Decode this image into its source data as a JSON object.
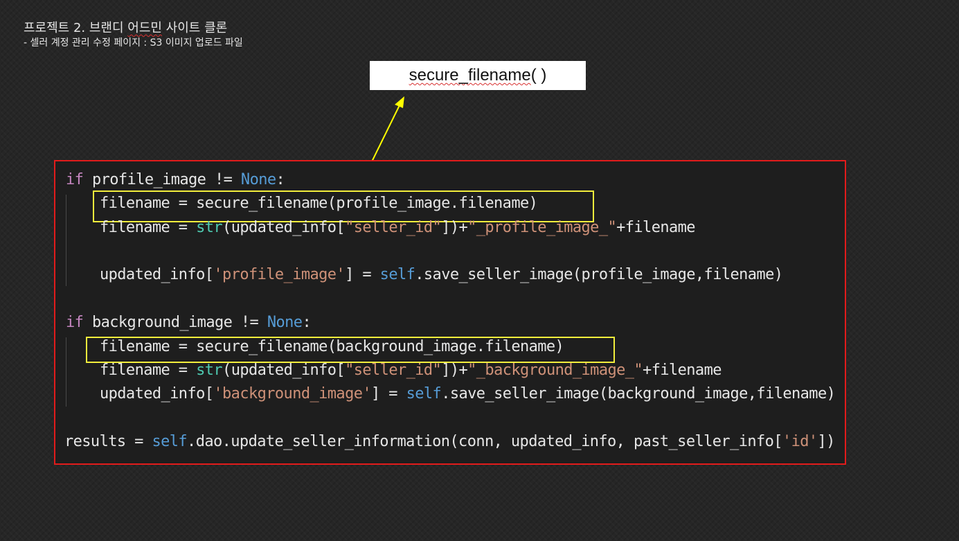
{
  "slide": {
    "title_prefix": "프로젝트 2. 브랜디 ",
    "title_word": "어드민",
    "title_suffix": " 사이트 클론",
    "subtitle": "- 셀러 계정 관리 수정 페이지 : S3 이미지 업로드 파일"
  },
  "callout": {
    "label_main": "secure_filename",
    "label_tail": "( )"
  },
  "code": {
    "line1": {
      "kw": "if",
      "a": " profile_image != ",
      "const": "None",
      "b": ":"
    },
    "line2": {
      "text": "filename = secure_filename(profile_image.filename)"
    },
    "line3": {
      "a": "filename = ",
      "builtin": "str",
      "b": "(updated_info[",
      "str1": "\"seller_id\"",
      "c": "])+",
      "str2": "\"_profile_image_\"",
      "d": "+filename"
    },
    "line4": {
      "a": "updated_info[",
      "str1": "'profile_image'",
      "b": "] = ",
      "self": "self",
      "c": ".save_seller_image(profile_image,filename)"
    },
    "line5": {
      "kw": "if",
      "a": " background_image != ",
      "const": "None",
      "b": ":"
    },
    "line6": {
      "text": "filename = secure_filename(background_image.filename)"
    },
    "line7": {
      "a": "filename = ",
      "builtin": "str",
      "b": "(updated_info[",
      "str1": "\"seller_id\"",
      "c": "])+",
      "str2": "\"_background_image_\"",
      "d": "+filename"
    },
    "line8": {
      "a": "updated_info[",
      "str1": "'background_image'",
      "b": "] = ",
      "self": "self",
      "c": ".save_seller_image(background_image,filename)"
    },
    "line9": {
      "a": "results = ",
      "self": "self",
      "b": ".dao.update_seller_information(conn, updated_info, past_seller_info[",
      "str1": "'id'",
      "c": "])"
    }
  },
  "colors": {
    "panel_border": "#e21b1b",
    "highlight_box": "#f2ee3c",
    "arrow": "#ffff00",
    "keyword": "#c586c0",
    "constant": "#569cd6",
    "builtin": "#4ec9b0",
    "string": "#ce9178"
  }
}
